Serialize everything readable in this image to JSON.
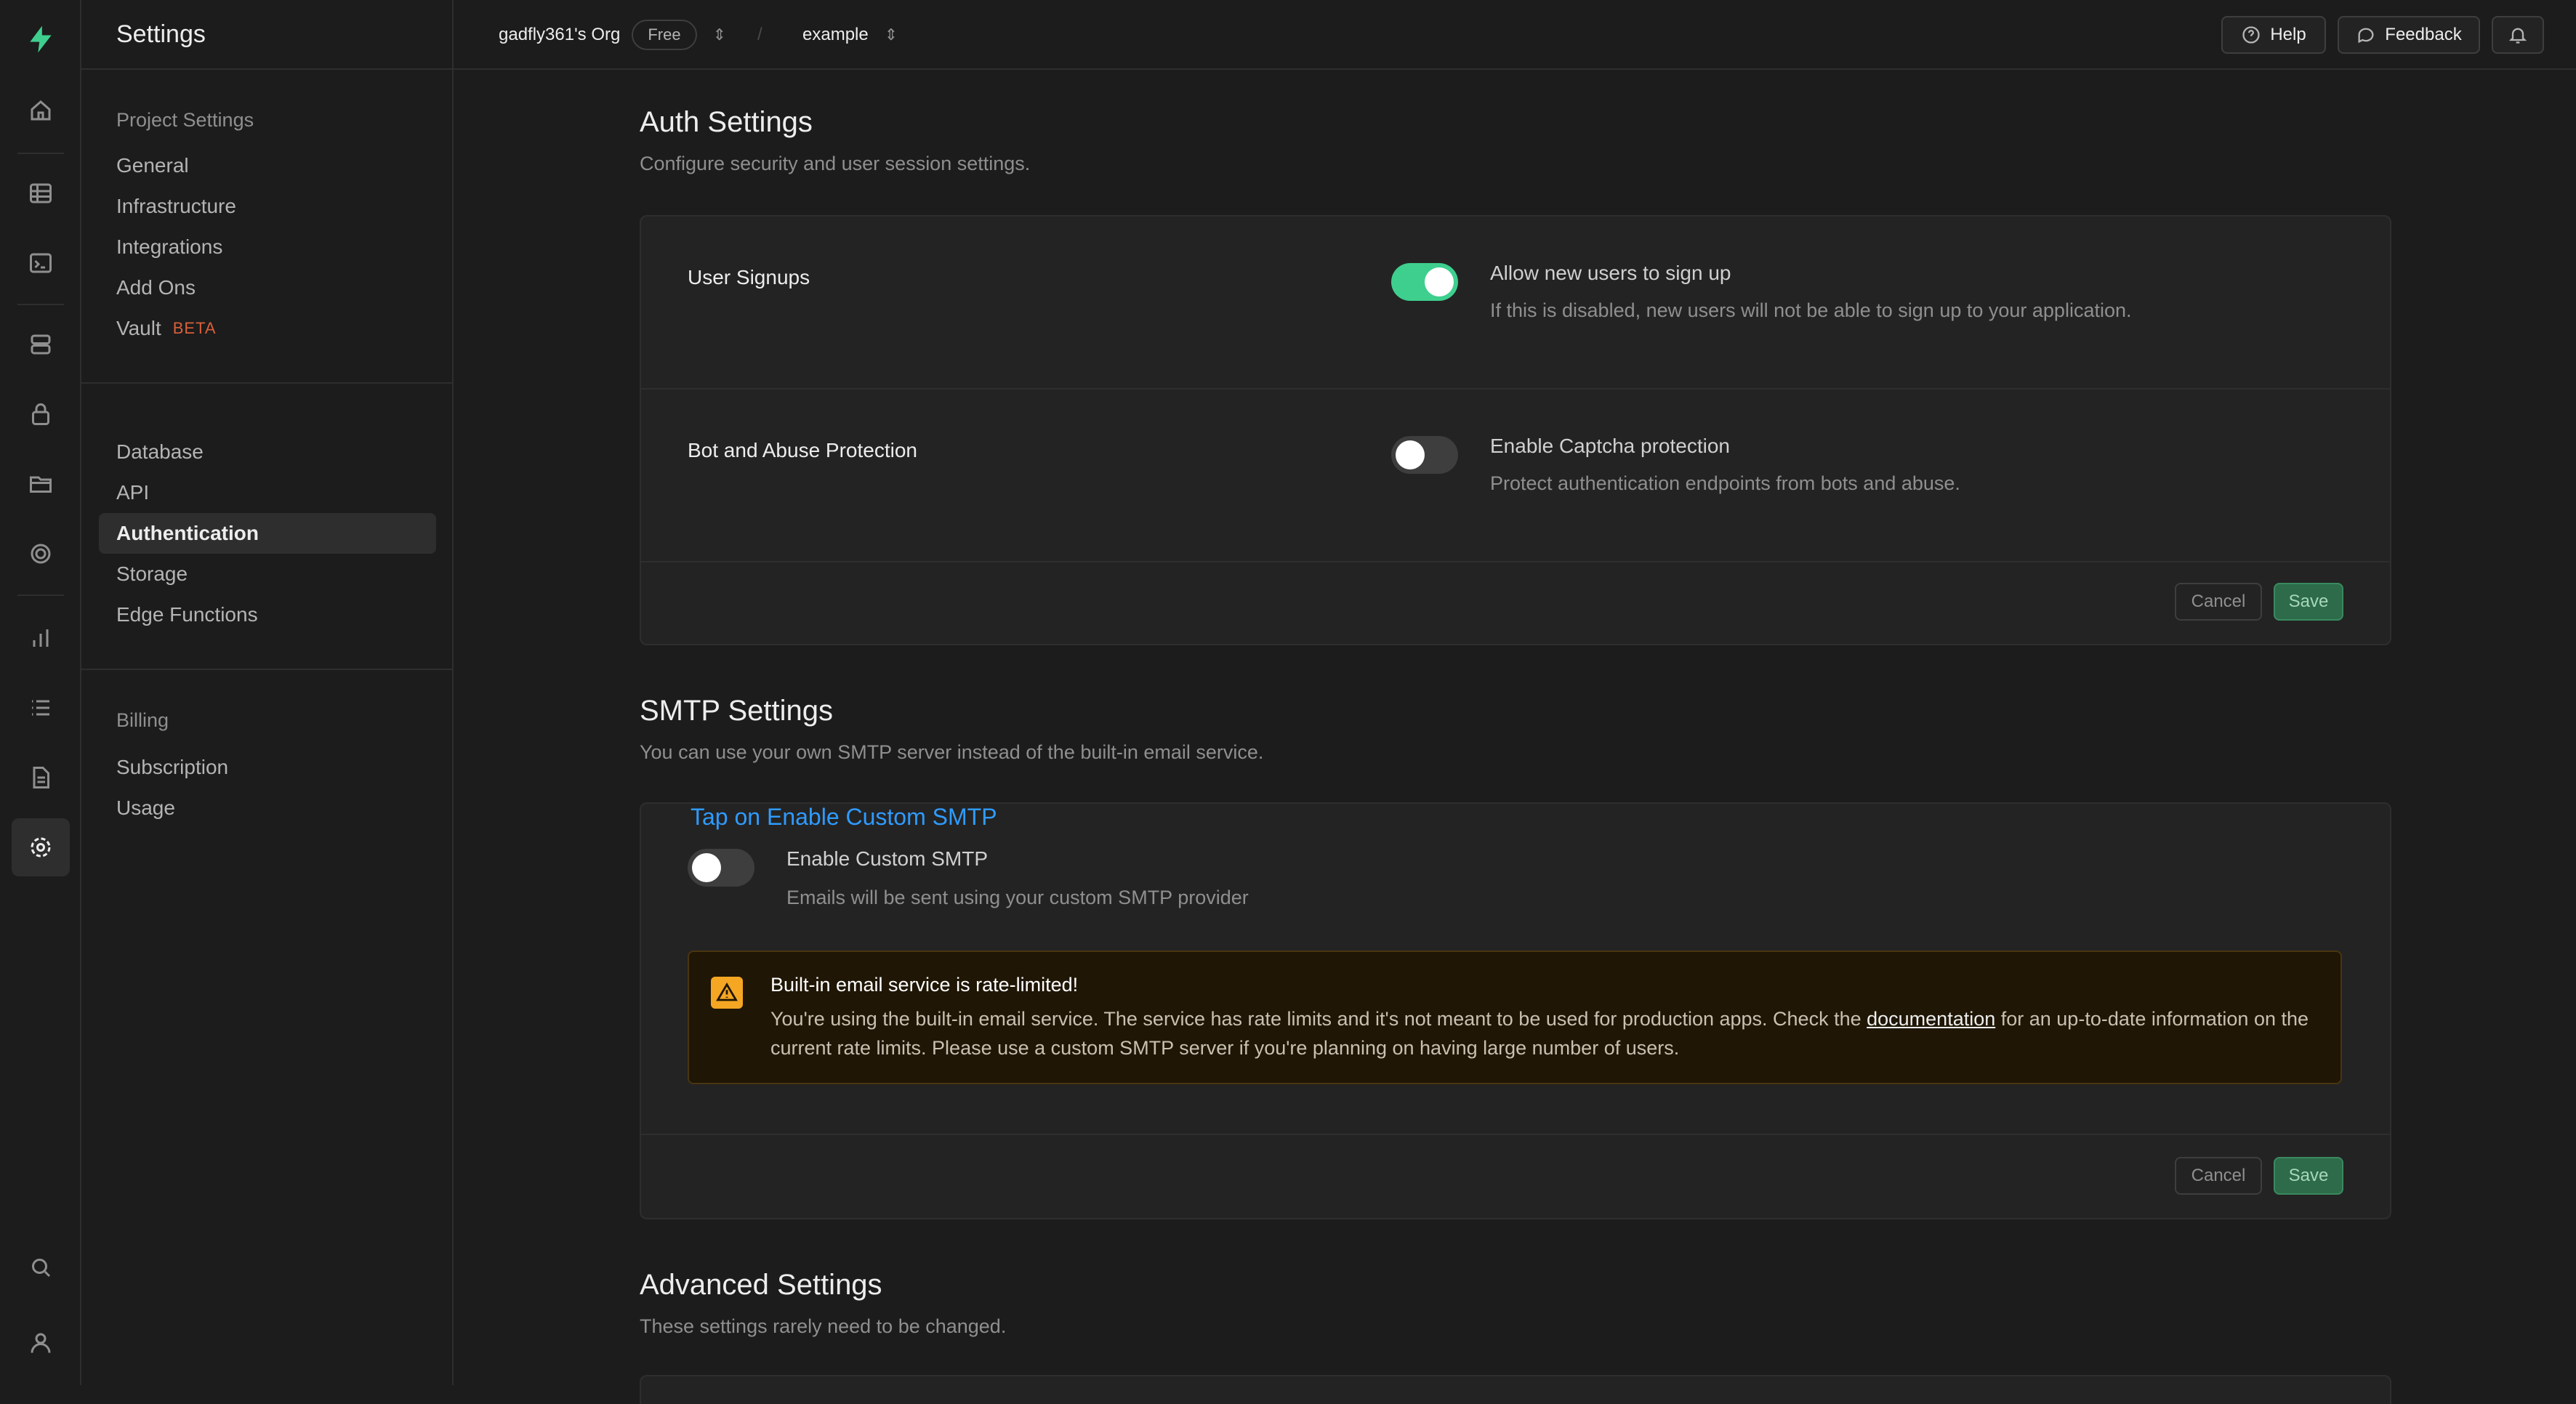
{
  "app": {
    "title": "Settings"
  },
  "topbar": {
    "org_name": "gadfly361's Org",
    "plan_badge": "Free",
    "separator": "/",
    "project_name": "example",
    "help_label": "Help",
    "feedback_label": "Feedback"
  },
  "rail": {
    "icons": [
      "logo-icon",
      "home-icon",
      "table-editor-icon",
      "sql-editor-icon",
      "database-icon",
      "auth-lock-icon",
      "storage-icon",
      "edge-functions-icon",
      "reports-icon",
      "logs-icon",
      "docs-icon",
      "settings-gear-icon",
      "search-icon",
      "user-icon"
    ]
  },
  "sidenav": {
    "groups": [
      {
        "title": "Project Settings",
        "items": [
          "General",
          "Infrastructure",
          "Integrations",
          "Add Ons",
          "Vault"
        ]
      },
      {
        "title": "",
        "items": [
          "Database",
          "API",
          "Authentication",
          "Storage",
          "Edge Functions"
        ]
      },
      {
        "title": "Billing",
        "items": [
          "Subscription",
          "Usage"
        ]
      }
    ],
    "vault_badge": "BETA",
    "active_item": "Authentication"
  },
  "auth": {
    "title": "Auth Settings",
    "subtitle": "Configure security and user session settings.",
    "rows": [
      {
        "label": "User Signups",
        "toggle_on": true,
        "heading": "Allow new users to sign up",
        "description": "If this is disabled, new users will not be able to sign up to your application."
      },
      {
        "label": "Bot and Abuse Protection",
        "toggle_on": false,
        "heading": "Enable Captcha protection",
        "description": "Protect authentication endpoints from bots and abuse."
      }
    ],
    "cancel_label": "Cancel",
    "save_label": "Save"
  },
  "smtp": {
    "title": "SMTP Settings",
    "subtitle": "You can use your own SMTP server instead of the built-in email service.",
    "hint": "Tap on Enable Custom SMTP",
    "toggle_on": false,
    "heading": "Enable Custom SMTP",
    "description": "Emails will be sent using your custom SMTP provider",
    "warning": {
      "title": "Built-in email service is rate-limited!",
      "body_before": "You're using the built-in email service. The service has rate limits and it's not meant to be used for production apps. Check the ",
      "link": "documentation",
      "body_after": " for an up-to-date information on the current rate limits. Please use a custom SMTP server if you're planning on having large number of users."
    },
    "cancel_label": "Cancel",
    "save_label": "Save"
  },
  "advanced": {
    "title": "Advanced Settings",
    "subtitle": "These settings rarely need to be changed."
  },
  "colors": {
    "accent": "#3ecf8e",
    "warning": "#f5a623",
    "hint": "#2f9bff",
    "background": "#1c1c1c"
  }
}
